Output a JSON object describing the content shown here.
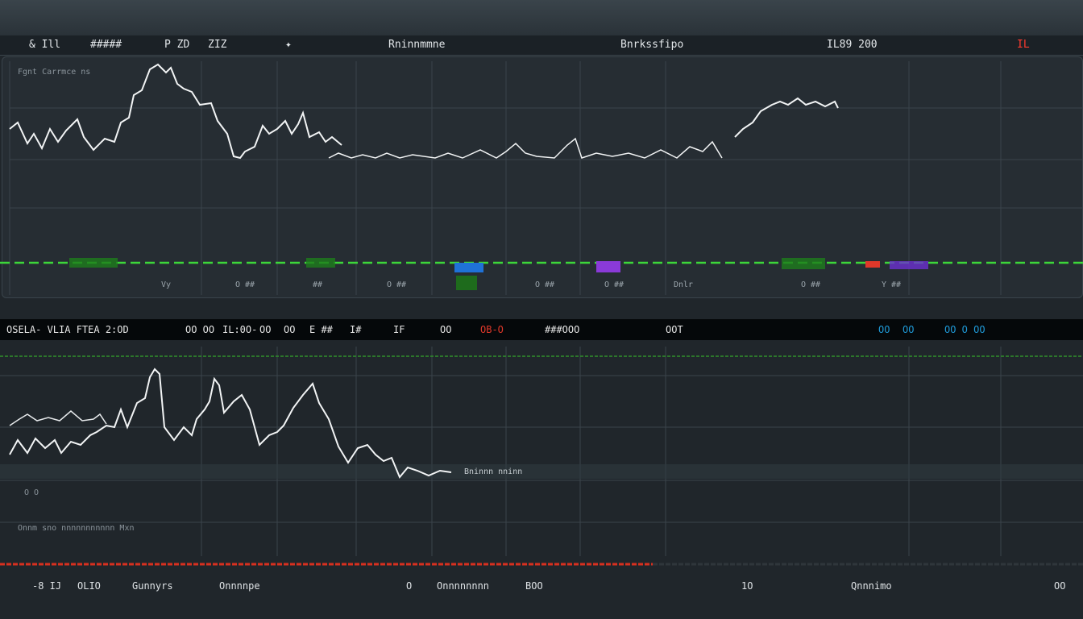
{
  "header": {
    "left_label_1": "& Ill",
    "left_label_2": "#####",
    "left_label_3": "P ZD",
    "left_label_4": "ZIZ",
    "center_label_1": "Rninnmmne",
    "center_label_2": "Bnrkssfipo",
    "right_value": "IL89 200",
    "alert_label": "IL"
  },
  "top_panel": {
    "caption": "Fgnt Carrmce ns",
    "legend": [
      "Vy",
      "O ##",
      "##",
      "O ##",
      "O ##",
      "O ##",
      "Dnlr",
      "O ##",
      "Y ##"
    ]
  },
  "ticker": {
    "items": [
      "OSELA- VLIA FTEA 2:OD",
      "OO OO",
      "IL:0O-",
      "OO",
      "OO",
      "E ##",
      "I#",
      "IF",
      "OO",
      "OB-O",
      "###OOO",
      "OOT",
      "OO",
      "OO",
      "OO O OO"
    ]
  },
  "bottom_panel": {
    "caption_1": "O O",
    "caption_2": "Onnm sno nnnnnnnnnnn Mxn",
    "mid_label": "Bninnn nninn"
  },
  "footer": {
    "items": [
      "-8 IJ",
      "OLIO",
      "Gunnyrs",
      "Onnnnpe",
      "O",
      "Onnnnnnnn",
      "BOO",
      "1O",
      "Qnnnimo",
      "OO"
    ]
  },
  "colors": {
    "green_line": "#3cd63a",
    "red_line": "#d8301f",
    "accent_blue": "#1f72d8",
    "accent_purple": "#8a3ad8",
    "accent_red": "#e0382a"
  }
}
